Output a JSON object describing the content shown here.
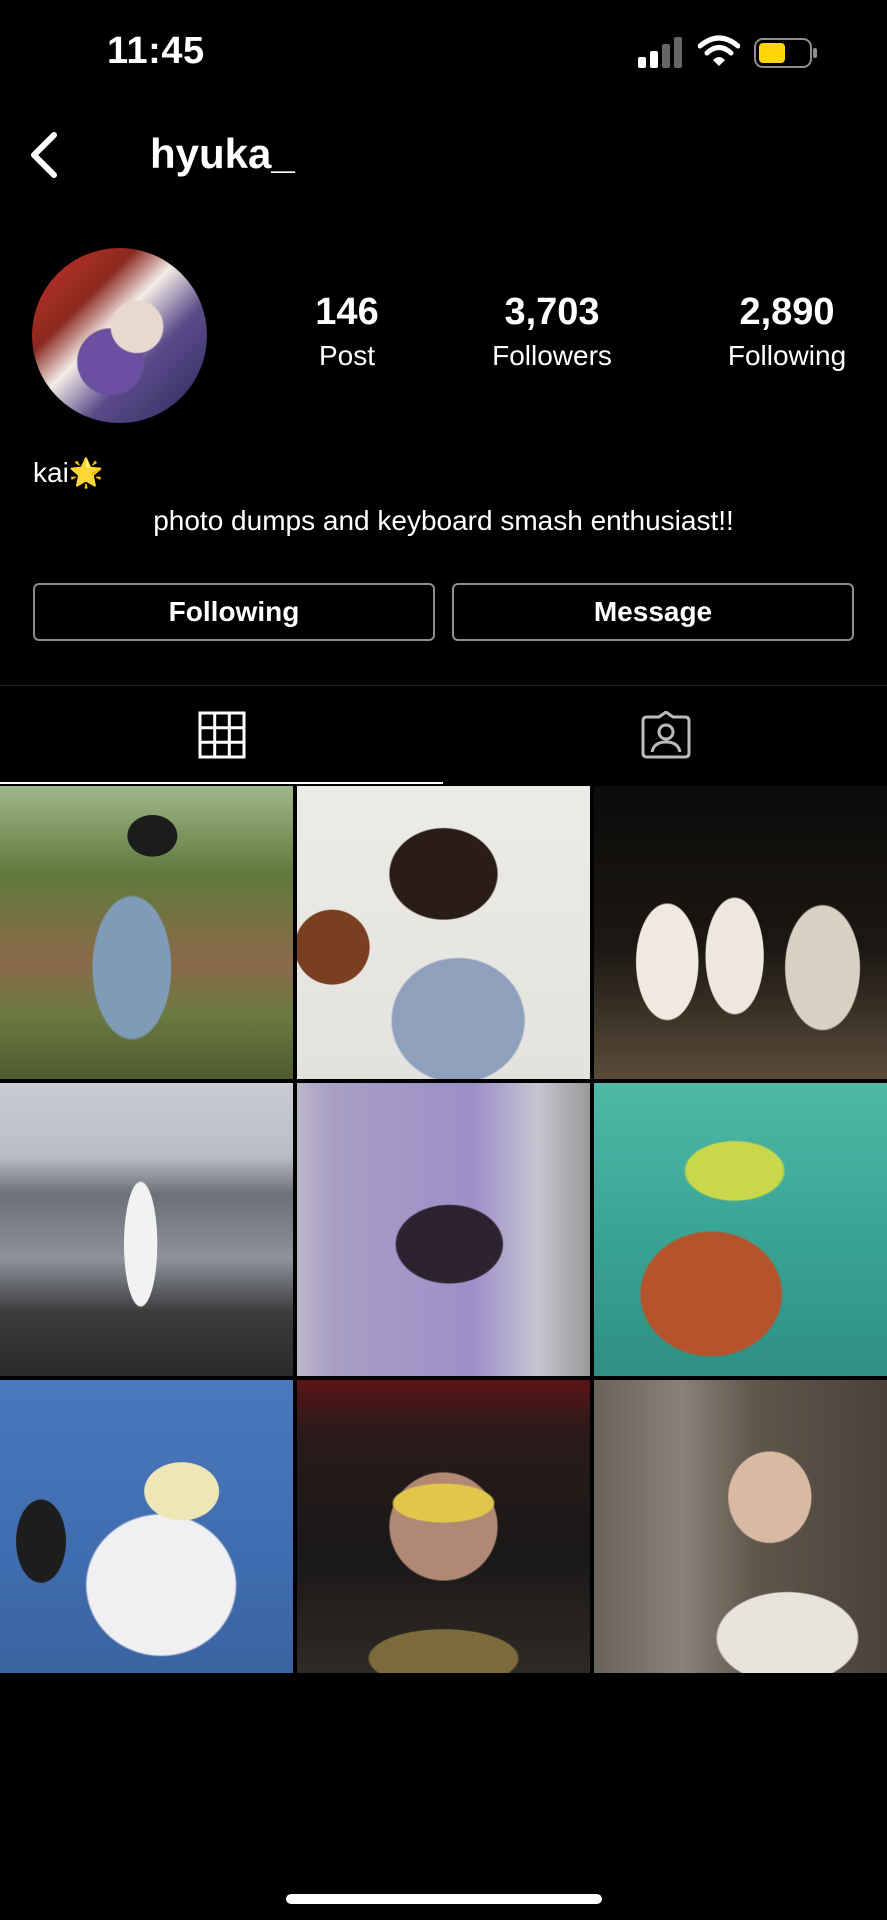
{
  "status_bar": {
    "time": "11:45"
  },
  "header": {
    "username": "hyuka_"
  },
  "profile": {
    "stats": [
      {
        "value": "146",
        "label": "Post"
      },
      {
        "value": "3,703",
        "label": "Followers"
      },
      {
        "value": "2,890",
        "label": "Following"
      }
    ],
    "display_name": "kai🌟",
    "bio": "photo dumps and keyboard smash enthusiast!!"
  },
  "actions": {
    "following_label": "Following",
    "message_label": "Message"
  },
  "tabs": [
    {
      "icon": "grid-icon",
      "active": true
    },
    {
      "icon": "tagged-person-icon",
      "active": false
    }
  ],
  "colors": {
    "background": "#000000",
    "battery": "#ffd60a",
    "button_border": "#8e8e8e"
  }
}
